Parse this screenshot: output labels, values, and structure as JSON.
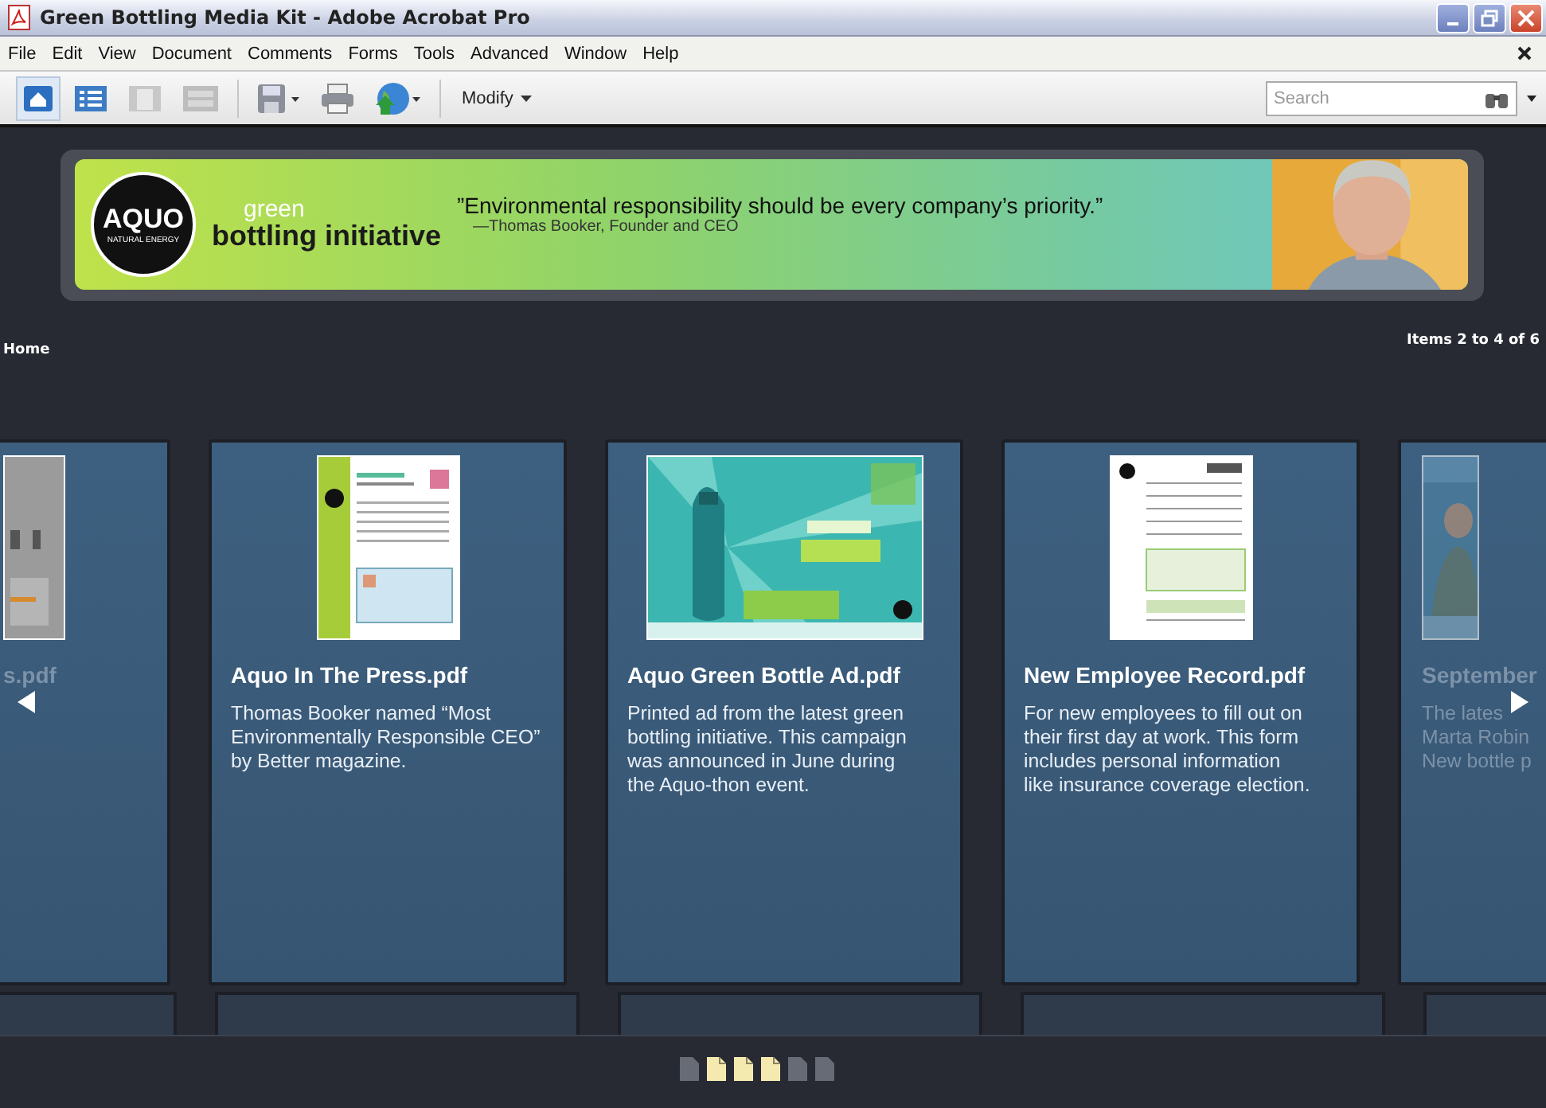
{
  "window": {
    "title": "Green Bottling Media Kit - Adobe Acrobat Pro"
  },
  "menu": [
    "File",
    "Edit",
    "View",
    "Document",
    "Comments",
    "Forms",
    "Tools",
    "Advanced",
    "Window",
    "Help"
  ],
  "toolbar": {
    "tools": [
      {
        "kind": "home",
        "selected": true
      },
      {
        "kind": "list",
        "selected": false
      },
      {
        "kind": "page",
        "selected": false
      },
      {
        "kind": "card",
        "selected": false
      },
      {
        "kind": "save",
        "selected": false
      },
      {
        "kind": "print",
        "selected": false
      },
      {
        "kind": "globe",
        "selected": false
      }
    ],
    "modify": "Modify",
    "search": {
      "placeholder": "Search"
    }
  },
  "banner": {
    "logo": "AQUO",
    "logo_sub": "NATURAL ENERGY",
    "brand_top": "green",
    "brand": "bottling initiative",
    "quote": "”Environmental responsibility should be every company’s priority.”",
    "attribution": "—Thomas Booker, Founder and CEO"
  },
  "breadcrumb": "Home",
  "items_count": "Items 2 to 4 of 6",
  "cards": [
    {
      "kind": "left-edge",
      "title": "s.pdf",
      "thumbnail": {
        "kind": "gray"
      }
    },
    {
      "kind": "full",
      "title": "Aquo In The Press.pdf",
      "thumbnail": {
        "kind": "press"
      },
      "description": "Thomas Booker named “Most\nEnvironmentally Responsible CEO”\nby Better magazine."
    },
    {
      "kind": "full",
      "title": "Aquo Green Bottle Ad.pdf",
      "thumbnail": {
        "kind": "ad"
      },
      "description": "Printed ad from the latest green\nbottling initiative. This campaign\nwas announced in June during\nthe Aquo-thon event."
    },
    {
      "kind": "full",
      "title": "New Employee Record.pdf",
      "thumbnail": {
        "kind": "form"
      },
      "description": "For new employees to fill out on\ntheir first day at work. This form\nincludes personal information\nlike insurance coverage election."
    },
    {
      "kind": "right-edge",
      "title": "September",
      "thumbnail": {
        "kind": "magazine"
      },
      "description": "The lates\nMarta Robin\nNew bottle p"
    }
  ],
  "pages": [
    {
      "selected": false
    },
    {
      "selected": true
    },
    {
      "selected": true
    },
    {
      "selected": true
    },
    {
      "selected": false
    },
    {
      "selected": false
    }
  ]
}
